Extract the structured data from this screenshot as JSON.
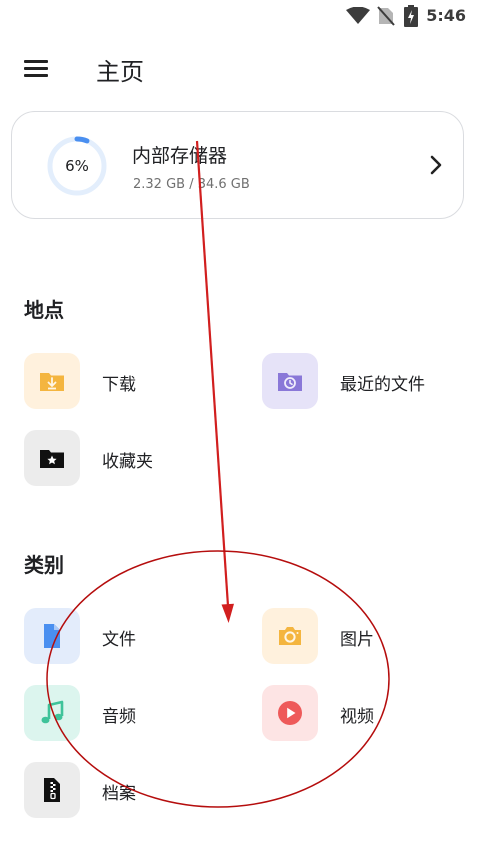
{
  "status_bar": {
    "time": "5:46"
  },
  "app_bar": {
    "title": "主页",
    "menu_icon": "menu-icon"
  },
  "storage": {
    "title": "内部存储器",
    "usage": "2.32 GB / 34.6 GB",
    "percent_label": "6%",
    "percent_value": 6
  },
  "places": {
    "title": "地点",
    "items": [
      {
        "label": "下载",
        "icon": "download-folder-icon"
      },
      {
        "label": "最近的文件",
        "icon": "recent-folder-icon"
      },
      {
        "label": "收藏夹",
        "icon": "starred-folder-icon"
      }
    ]
  },
  "categories": {
    "title": "类别",
    "items": [
      {
        "label": "文件",
        "icon": "document-icon"
      },
      {
        "label": "图片",
        "icon": "camera-icon"
      },
      {
        "label": "音频",
        "icon": "music-note-icon"
      },
      {
        "label": "视频",
        "icon": "play-icon"
      },
      {
        "label": "档案",
        "icon": "archive-icon"
      }
    ]
  },
  "colors": {
    "accent_blue": "#4a8ff0",
    "download_bg": "#fff1dd",
    "download_fg": "#f4b53f",
    "recent_bg": "#e6e3f8",
    "recent_fg": "#8a78d8",
    "starred_bg": "#ececec",
    "doc_bg": "#e3ecfb",
    "photo_bg": "#fff1dd",
    "audio_bg": "#dcf5ee",
    "audio_fg": "#3fc39a",
    "video_bg": "#fde4e4",
    "video_fg": "#ee5a5a",
    "archive_bg": "#ececec",
    "annotation_red": "#d11f1f"
  }
}
